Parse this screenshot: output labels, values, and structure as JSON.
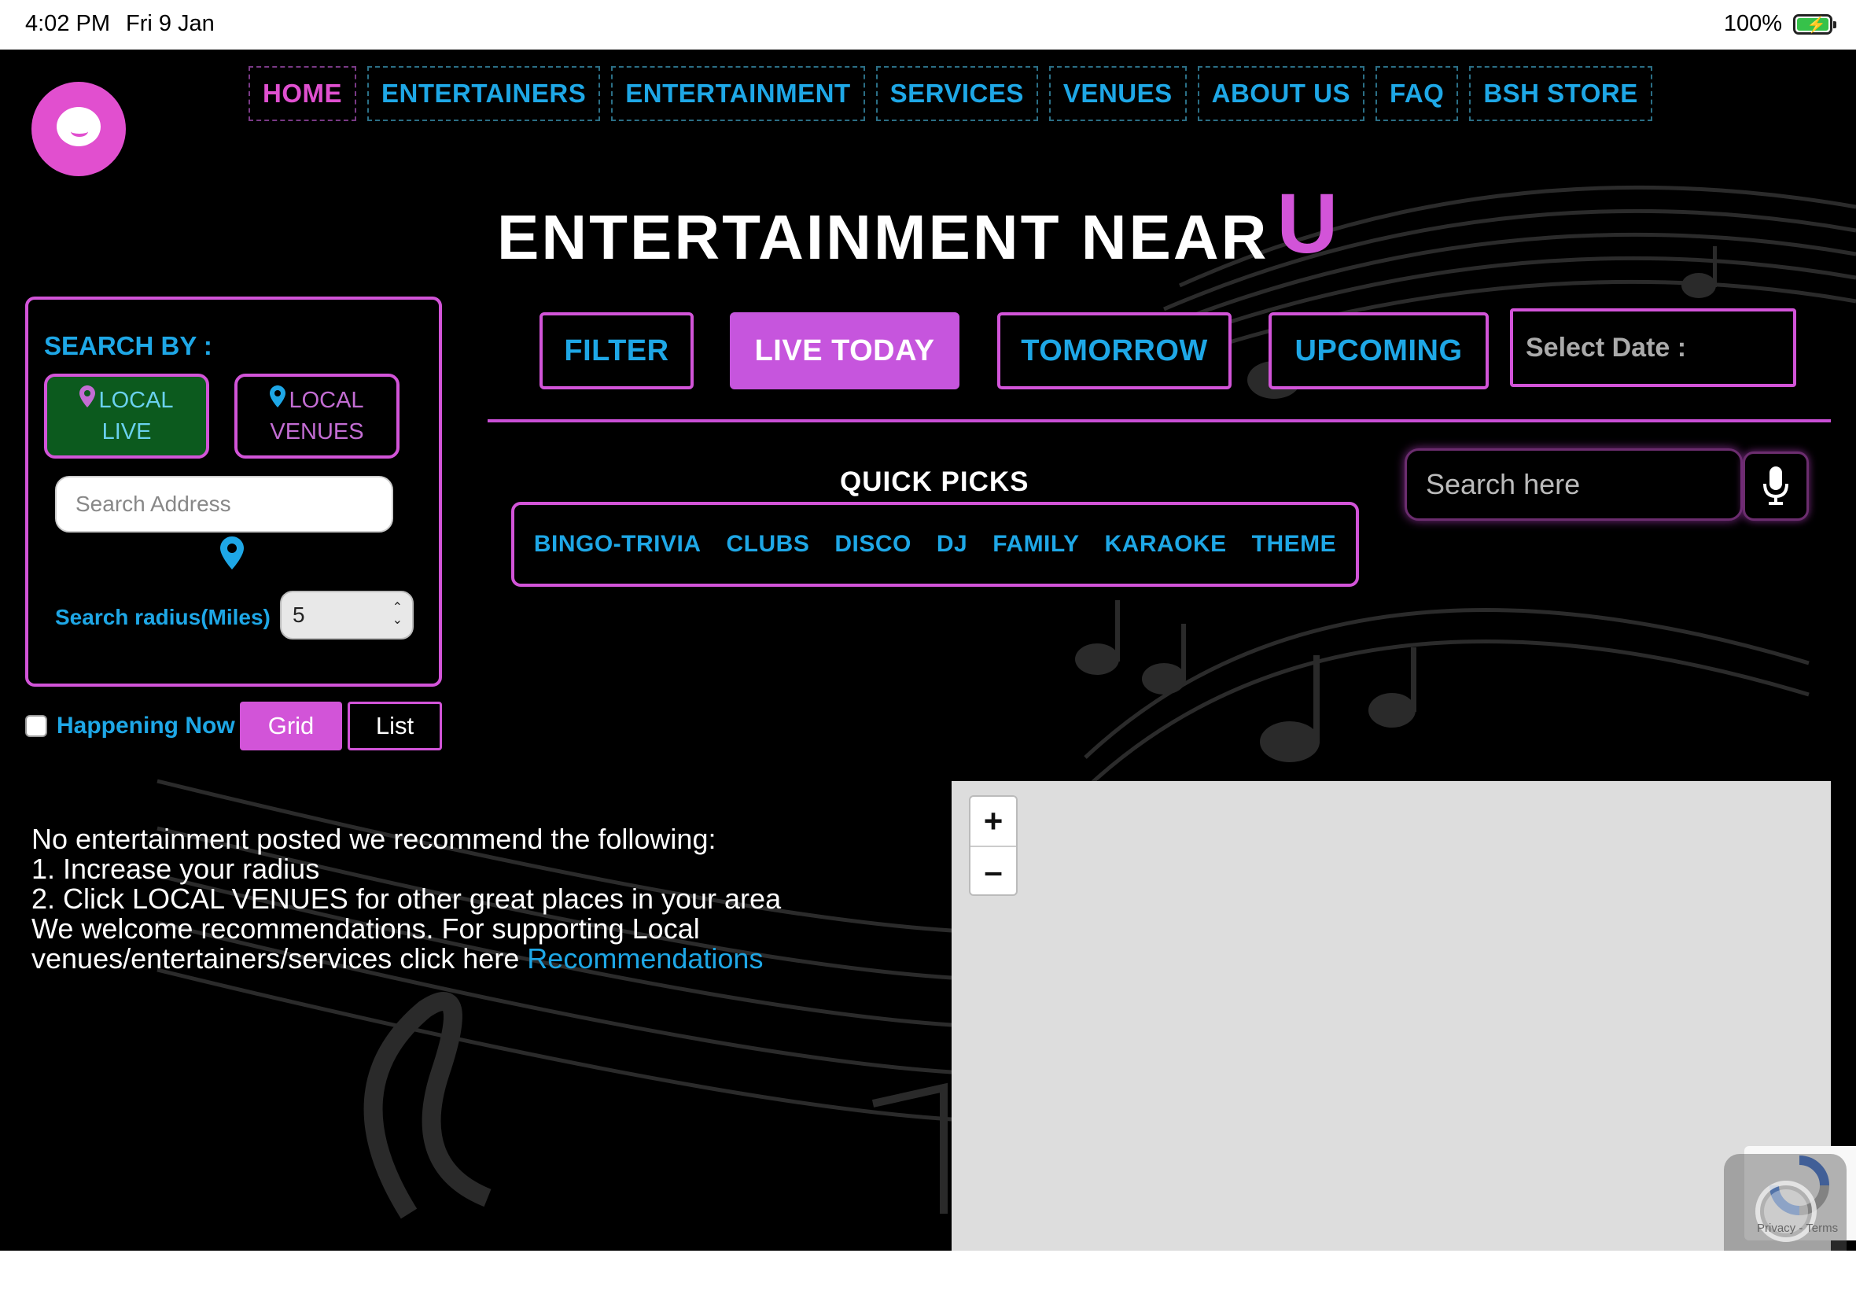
{
  "status": {
    "time": "4:02 PM",
    "date": "Fri 9 Jan",
    "battery": "100%"
  },
  "nav": {
    "items": [
      {
        "label": "HOME",
        "active": true
      },
      {
        "label": "ENTERTAINERS",
        "active": false
      },
      {
        "label": "ENTERTAINMENT",
        "active": false
      },
      {
        "label": "SERVICES",
        "active": false
      },
      {
        "label": "VENUES",
        "active": false
      },
      {
        "label": "ABOUT US",
        "active": false
      },
      {
        "label": "FAQ",
        "active": false
      },
      {
        "label": "BSH STORE",
        "active": false
      }
    ]
  },
  "hero": {
    "title": "ENTERTAINMENT NEAR",
    "accent": "U"
  },
  "search_panel": {
    "title": "SEARCH BY :",
    "local_live": {
      "line1": "LOCAL",
      "line2": "LIVE"
    },
    "local_venues": {
      "line1": "LOCAL",
      "line2": "VENUES"
    },
    "address_placeholder": "Search Address",
    "radius_label": "Search radius(Miles)",
    "radius_value": "5"
  },
  "view": {
    "happening_now": "Happening Now",
    "grid": "Grid",
    "list": "List"
  },
  "filters": {
    "filter": "FILTER",
    "live_today": "LIVE TODAY",
    "tomorrow": "TOMORROW",
    "upcoming": "UPCOMING",
    "select_date": "Select Date :"
  },
  "quick_picks": {
    "title": "QUICK PICKS",
    "items": [
      "BINGO-TRIVIA",
      "CLUBS",
      "DISCO",
      "DJ",
      "FAMILY",
      "KARAOKE",
      "THEME"
    ]
  },
  "search": {
    "placeholder": "Search here"
  },
  "message": {
    "line1": "No entertainment posted we recommend the following:",
    "line2": "1. Increase your radius",
    "line3": "2. Click LOCAL VENUES for other great places in your area",
    "line4": "We welcome recommendations. For supporting Local",
    "line5": "venues/entertainers/services click here",
    "link": "Recommendations"
  },
  "map": {
    "zoom_in": "+",
    "zoom_out": "–"
  },
  "recaptcha": {
    "text": "Privacy - Terms"
  },
  "colors": {
    "accent_pink": "#d254d8",
    "link_blue": "#1ea7e6",
    "live_green": "#0c5a1e",
    "background": "#000000"
  }
}
